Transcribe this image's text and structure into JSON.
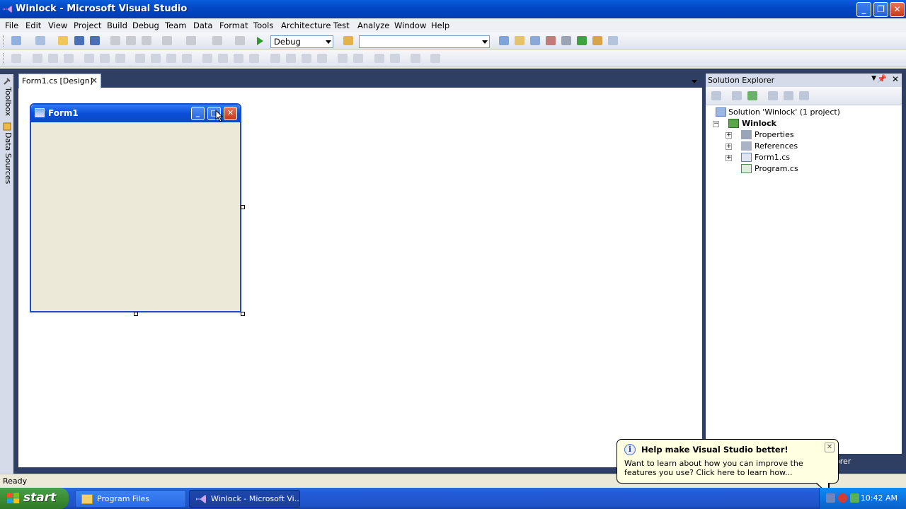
{
  "window": {
    "title": "Winlock - Microsoft Visual Studio"
  },
  "menu": [
    "File",
    "Edit",
    "View",
    "Project",
    "Build",
    "Debug",
    "Team",
    "Data",
    "Format",
    "Tools",
    "Architecture",
    "Test",
    "Analyze",
    "Window",
    "Help"
  ],
  "toolbar": {
    "configuration": "Debug",
    "platform": ""
  },
  "left_tabs": {
    "toolbox": "Toolbox",
    "data_sources": "Data Sources"
  },
  "document": {
    "tab_label": "Form1.cs [Design]"
  },
  "form": {
    "title": "Form1"
  },
  "solution_explorer": {
    "title": "Solution Explorer",
    "solution": "Solution 'Winlock' (1 project)",
    "project": "Winlock",
    "items": [
      "Properties",
      "References",
      "Form1.cs",
      "Program.cs"
    ],
    "partial_tab": "orer"
  },
  "status": {
    "text": "Ready"
  },
  "balloon": {
    "title": "Help make Visual Studio better!",
    "body": "Want to learn about how you can improve the features you use? Click here to learn how..."
  },
  "taskbar": {
    "start": "start",
    "tasks": [
      "Program Files",
      "Winlock - Microsoft Vi..."
    ],
    "clock": "10:42 AM"
  },
  "colors": {
    "titlebar": "#0348C5",
    "workspace": "#2F3E63",
    "balloon": "#FFFFE1",
    "start": "#3C8C35"
  }
}
